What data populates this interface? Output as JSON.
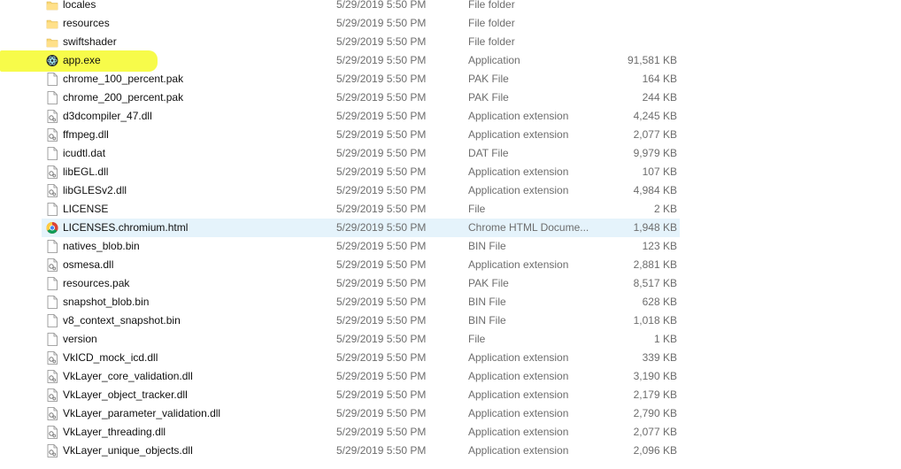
{
  "files": [
    {
      "name": "locales",
      "date": "5/29/2019 5:50 PM",
      "type": "File folder",
      "size": "",
      "icon": "folder-icon"
    },
    {
      "name": "resources",
      "date": "5/29/2019 5:50 PM",
      "type": "File folder",
      "size": "",
      "icon": "folder-icon"
    },
    {
      "name": "swiftshader",
      "date": "5/29/2019 5:50 PM",
      "type": "File folder",
      "size": "",
      "icon": "folder-icon"
    },
    {
      "name": "app.exe",
      "date": "5/29/2019 5:50 PM",
      "type": "Application",
      "size": "91,581 KB",
      "icon": "app-exe-icon"
    },
    {
      "name": "chrome_100_percent.pak",
      "date": "5/29/2019 5:50 PM",
      "type": "PAK File",
      "size": "164 KB",
      "icon": "file-icon"
    },
    {
      "name": "chrome_200_percent.pak",
      "date": "5/29/2019 5:50 PM",
      "type": "PAK File",
      "size": "244 KB",
      "icon": "file-icon"
    },
    {
      "name": "d3dcompiler_47.dll",
      "date": "5/29/2019 5:50 PM",
      "type": "Application extension",
      "size": "4,245 KB",
      "icon": "dll-file-icon"
    },
    {
      "name": "ffmpeg.dll",
      "date": "5/29/2019 5:50 PM",
      "type": "Application extension",
      "size": "2,077 KB",
      "icon": "dll-file-icon"
    },
    {
      "name": "icudtl.dat",
      "date": "5/29/2019 5:50 PM",
      "type": "DAT File",
      "size": "9,979 KB",
      "icon": "file-icon"
    },
    {
      "name": "libEGL.dll",
      "date": "5/29/2019 5:50 PM",
      "type": "Application extension",
      "size": "107 KB",
      "icon": "dll-file-icon"
    },
    {
      "name": "libGLESv2.dll",
      "date": "5/29/2019 5:50 PM",
      "type": "Application extension",
      "size": "4,984 KB",
      "icon": "dll-file-icon"
    },
    {
      "name": "LICENSE",
      "date": "5/29/2019 5:50 PM",
      "type": "File",
      "size": "2 KB",
      "icon": "file-icon"
    },
    {
      "name": "LICENSES.chromium.html",
      "date": "5/29/2019 5:50 PM",
      "type": "Chrome HTML Docume...",
      "size": "1,948 KB",
      "icon": "chrome-icon",
      "hover": true
    },
    {
      "name": "natives_blob.bin",
      "date": "5/29/2019 5:50 PM",
      "type": "BIN File",
      "size": "123 KB",
      "icon": "file-icon"
    },
    {
      "name": "osmesa.dll",
      "date": "5/29/2019 5:50 PM",
      "type": "Application extension",
      "size": "2,881 KB",
      "icon": "dll-file-icon"
    },
    {
      "name": "resources.pak",
      "date": "5/29/2019 5:50 PM",
      "type": "PAK File",
      "size": "8,517 KB",
      "icon": "file-icon"
    },
    {
      "name": "snapshot_blob.bin",
      "date": "5/29/2019 5:50 PM",
      "type": "BIN File",
      "size": "628 KB",
      "icon": "file-icon"
    },
    {
      "name": "v8_context_snapshot.bin",
      "date": "5/29/2019 5:50 PM",
      "type": "BIN File",
      "size": "1,018 KB",
      "icon": "file-icon"
    },
    {
      "name": "version",
      "date": "5/29/2019 5:50 PM",
      "type": "File",
      "size": "1 KB",
      "icon": "file-icon"
    },
    {
      "name": "VkICD_mock_icd.dll",
      "date": "5/29/2019 5:50 PM",
      "type": "Application extension",
      "size": "339 KB",
      "icon": "dll-file-icon"
    },
    {
      "name": "VkLayer_core_validation.dll",
      "date": "5/29/2019 5:50 PM",
      "type": "Application extension",
      "size": "3,190 KB",
      "icon": "dll-file-icon"
    },
    {
      "name": "VkLayer_object_tracker.dll",
      "date": "5/29/2019 5:50 PM",
      "type": "Application extension",
      "size": "2,179 KB",
      "icon": "dll-file-icon"
    },
    {
      "name": "VkLayer_parameter_validation.dll",
      "date": "5/29/2019 5:50 PM",
      "type": "Application extension",
      "size": "2,790 KB",
      "icon": "dll-file-icon"
    },
    {
      "name": "VkLayer_threading.dll",
      "date": "5/29/2019 5:50 PM",
      "type": "Application extension",
      "size": "2,077 KB",
      "icon": "dll-file-icon"
    },
    {
      "name": "VkLayer_unique_objects.dll",
      "date": "5/29/2019 5:50 PM",
      "type": "Application extension",
      "size": "2,096 KB",
      "icon": "dll-file-icon"
    }
  ],
  "highlighted_file_index": 3,
  "colors": {
    "highlight": "#f6fa2a",
    "hover": "#e5f3fb",
    "folder": "#f8d775",
    "secondary_text": "#6d6d6d"
  }
}
